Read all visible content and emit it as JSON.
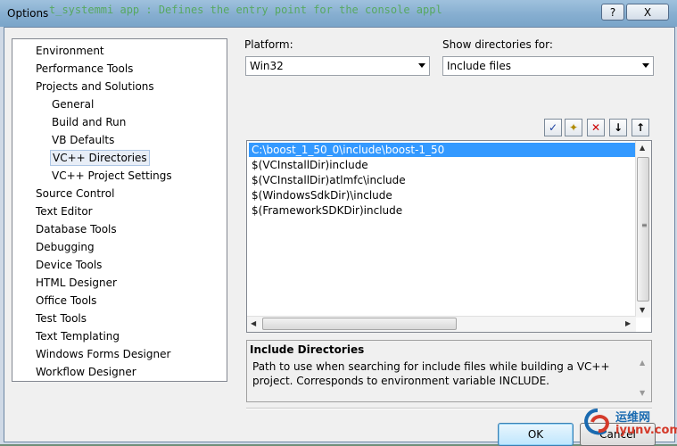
{
  "window": {
    "title": "Options",
    "bg_code_text": "t_systemmi app : Defines the entry point for the console appl"
  },
  "titlebar": {
    "help_glyph": "?",
    "close_glyph": "X"
  },
  "tree": {
    "items": [
      {
        "label": "Environment",
        "level": 0
      },
      {
        "label": "Performance Tools",
        "level": 0
      },
      {
        "label": "Projects and Solutions",
        "level": 0
      },
      {
        "label": "General",
        "level": 1
      },
      {
        "label": "Build and Run",
        "level": 1
      },
      {
        "label": "VB Defaults",
        "level": 1
      },
      {
        "label": "VC++ Directories",
        "level": 1,
        "selected": true
      },
      {
        "label": "VC++ Project Settings",
        "level": 1
      },
      {
        "label": "Source Control",
        "level": 0
      },
      {
        "label": "Text Editor",
        "level": 0
      },
      {
        "label": "Database Tools",
        "level": 0
      },
      {
        "label": "Debugging",
        "level": 0
      },
      {
        "label": "Device Tools",
        "level": 0
      },
      {
        "label": "HTML Designer",
        "level": 0
      },
      {
        "label": "Office Tools",
        "level": 0
      },
      {
        "label": "Test Tools",
        "level": 0
      },
      {
        "label": "Text Templating",
        "level": 0
      },
      {
        "label": "Windows Forms Designer",
        "level": 0
      },
      {
        "label": "Workflow Designer",
        "level": 0
      }
    ]
  },
  "platform": {
    "label": "Platform:",
    "value": "Win32"
  },
  "show_dirs": {
    "label": "Show directories for:",
    "value": "Include files"
  },
  "toolbar": {
    "check_glyph": "✓",
    "newfolder_glyph": "✦",
    "delete_glyph": "✕",
    "down_glyph": "↓",
    "up_glyph": "↑"
  },
  "directories": {
    "rows": [
      {
        "path": "C:\\boost_1_50_0\\include\\boost-1_50",
        "selected": true
      },
      {
        "path": "$(VCInstallDir)include"
      },
      {
        "path": "$(VCInstallDir)atlmfc\\include"
      },
      {
        "path": "$(WindowsSdkDir)\\include"
      },
      {
        "path": "$(FrameworkSDKDir)include"
      }
    ]
  },
  "description": {
    "title": "Include Directories",
    "text": "Path to use when searching for include files while building a VC++ project.  Corresponds to environment variable INCLUDE."
  },
  "buttons": {
    "ok": "OK",
    "cancel": "Cancel"
  },
  "watermark": {
    "line1": "运维网",
    "line2": "iyunv.com"
  },
  "colors": {
    "selection": "#3399ff",
    "tree_selected": "#e8eef7",
    "title_bar": "#86aed0"
  }
}
